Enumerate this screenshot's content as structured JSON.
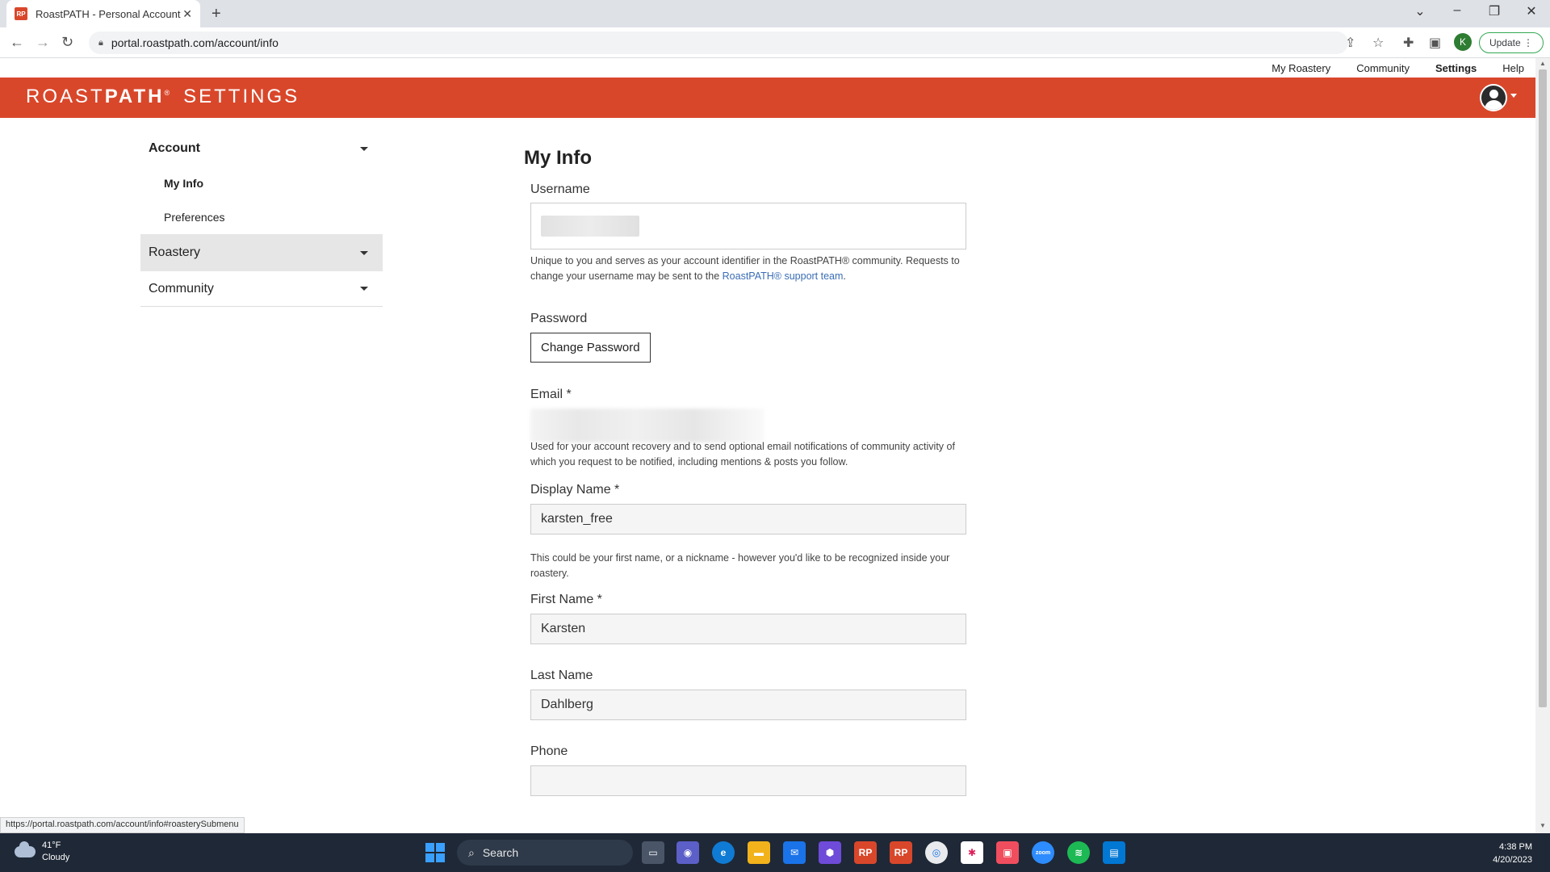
{
  "browser": {
    "tab_title": "RoastPATH - Personal Account",
    "tab_favicon": "RP",
    "url": "portal.roastpath.com/account/info",
    "profile_initial": "K",
    "update_label": "Update"
  },
  "top_nav": {
    "my_roastery": "My Roastery",
    "community": "Community",
    "settings": "Settings",
    "help": "Help"
  },
  "header": {
    "brand_roast": "ROAST",
    "brand_path": "PATH",
    "brand_mark": "®",
    "brand_settings": "SETTINGS",
    "accent_color": "#d9472b"
  },
  "sidebar": {
    "account": "Account",
    "my_info": "My Info",
    "preferences": "Preferences",
    "roastery": "Roastery",
    "community": "Community"
  },
  "form": {
    "title": "My Info",
    "username_label": "Username",
    "username_help_1": "Unique to you and serves as your account identifier in the RoastPATH® community. Requests to change your username may be sent to the ",
    "username_help_link": "RoastPATH® support team",
    "username_help_2": ".",
    "password_label": "Password",
    "change_password": "Change Password",
    "email_label": "Email *",
    "email_help": "Used for your account recovery and to send optional email notifications of community activity of which you request to be notified, including mentions & posts you follow.",
    "display_name_label": "Display Name *",
    "display_name_value": "karsten_free",
    "display_name_help": "This could be your first name, or a nickname - however you'd like to be recognized inside your roastery.",
    "first_name_label": "First Name *",
    "first_name_value": "Karsten",
    "last_name_label": "Last Name",
    "last_name_value": "Dahlberg",
    "phone_label": "Phone",
    "phone_value": ""
  },
  "status_url": "https://portal.roastpath.com/account/info#roasterySubmenu",
  "taskbar": {
    "temperature": "41°F",
    "condition": "Cloudy",
    "search": "Search",
    "time": "4:38 PM",
    "date": "4/20/2023"
  }
}
